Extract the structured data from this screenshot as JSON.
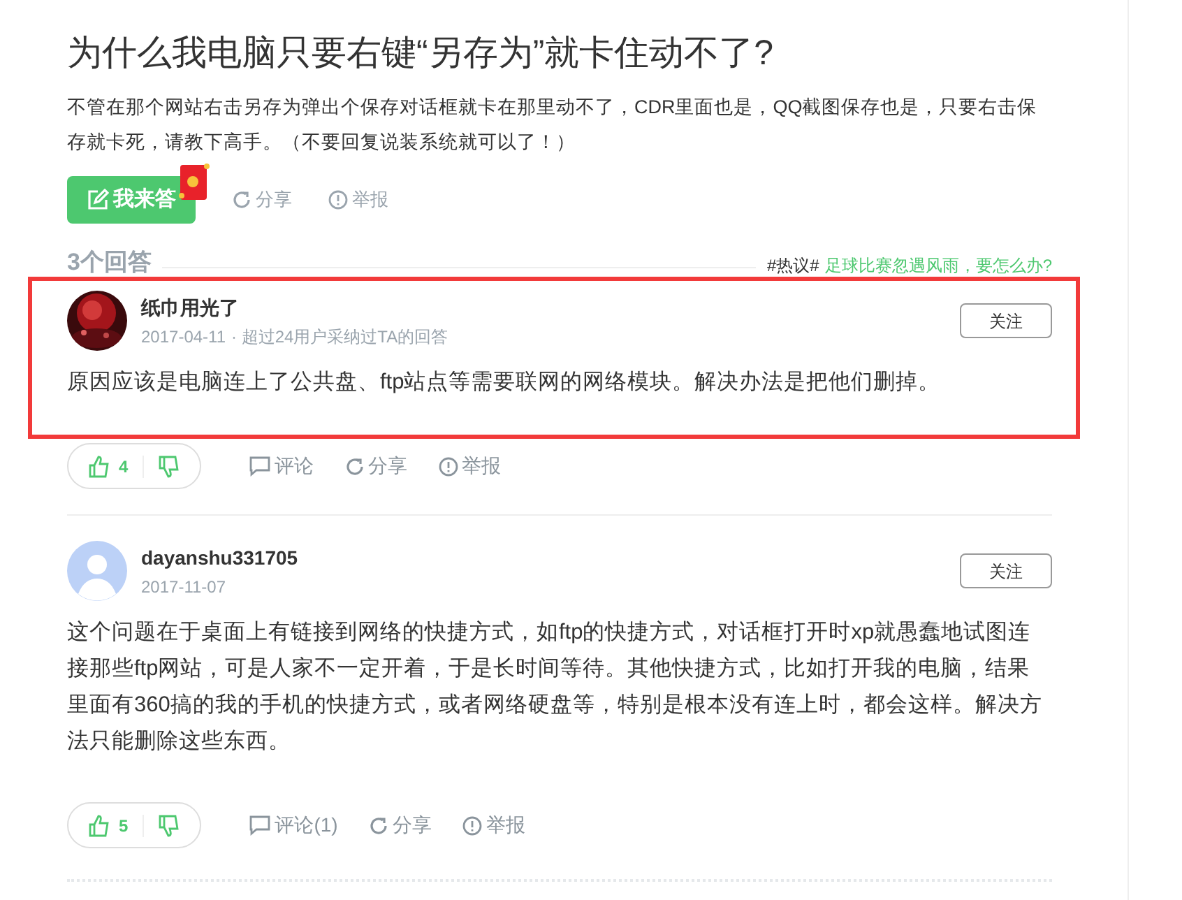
{
  "question": {
    "title": "为什么我电脑只要右键“另存为”就卡住动不了?",
    "body": "不管在那个网站右击另存为弹出个保存对话框就卡在那里动不了，CDR里面也是，QQ截图保存也是，只要右击保存就卡死，请教下高手。（不要回复说装系统就可以了！）",
    "answer_button": "我来答",
    "share": "分享",
    "report": "举报"
  },
  "answers_header": {
    "count": "3个回答",
    "hot_tag": "#热议#",
    "hot_link": "足球比赛忽遇风雨，要怎么办?"
  },
  "answers": [
    {
      "highlighted": true,
      "user": "纸巾用光了",
      "date": "2017-04-11",
      "meta": "· 超过24用户采纳过TA的回答",
      "follow": "关注",
      "text": "原因应该是电脑连上了公共盘、ftp站点等需要联网的网络模块。解决办法是把他们删掉。",
      "likes": "4",
      "comment": "评论",
      "share": "分享",
      "report": "举报"
    },
    {
      "highlighted": false,
      "avatar": {
        "kind": "default"
      },
      "user": "dayanshu331705",
      "date": "2017-11-07",
      "follow": "关注",
      "text": "这个问题在于桌面上有链接到网络的快捷方式，如ftp的快捷方式，对话框打开时xp就愚蠢地试图连接那些ftp网站，可是人家不一定开着，于是长时间等待。其他快捷方式，比如打开我的电脑，结果里面有360搞的我的手机的快捷方式，或者网络硬盘等，特别是根本没有连上时，都会这样。解决方法只能删除这些东西。",
      "likes": "5",
      "comment": "评论(1)",
      "share": "分享",
      "report": "举报"
    }
  ]
}
